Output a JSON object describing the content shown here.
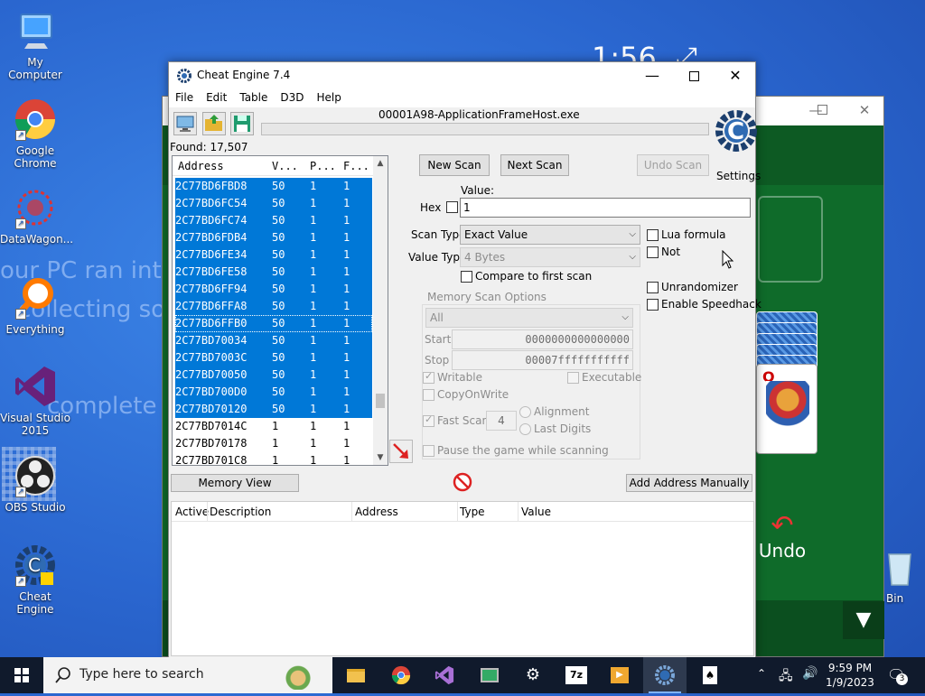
{
  "desktop": {
    "icons": [
      {
        "label": "My Computer"
      },
      {
        "label": "Google Chrome"
      },
      {
        "label": "DataWagon..."
      },
      {
        "label": "Everything"
      },
      {
        "label": "Visual Studio 2015"
      },
      {
        "label": "OBS Studio"
      },
      {
        "label": "Cheat Engine"
      },
      {
        "label": "e Bin"
      }
    ],
    "wallpaper_lines": [
      "our PC ran into",
      "collecting so",
      "complete"
    ]
  },
  "solitaire": {
    "timer": "1:56",
    "card_rank": "Q",
    "undo_label": "Undo",
    "colors": {
      "felt": "#0f6b2a"
    }
  },
  "cheat_engine": {
    "title": "Cheat Engine 7.4",
    "menu": [
      "File",
      "Edit",
      "Table",
      "D3D",
      "Help"
    ],
    "process": "00001A98-ApplicationFrameHost.exe",
    "found": "Found: 17,507",
    "settings_label": "Settings",
    "logo_text": "Cheat Engine",
    "results": {
      "columns": [
        "Address",
        "V...",
        "P...",
        "F..."
      ],
      "rows": [
        {
          "address": "2C77BD6FBD8",
          "value": "50",
          "prev": "1",
          "first": "1",
          "selected": true
        },
        {
          "address": "2C77BD6FC54",
          "value": "50",
          "prev": "1",
          "first": "1",
          "selected": true
        },
        {
          "address": "2C77BD6FC74",
          "value": "50",
          "prev": "1",
          "first": "1",
          "selected": true
        },
        {
          "address": "2C77BD6FDB4",
          "value": "50",
          "prev": "1",
          "first": "1",
          "selected": true
        },
        {
          "address": "2C77BD6FE34",
          "value": "50",
          "prev": "1",
          "first": "1",
          "selected": true
        },
        {
          "address": "2C77BD6FE58",
          "value": "50",
          "prev": "1",
          "first": "1",
          "selected": true
        },
        {
          "address": "2C77BD6FF94",
          "value": "50",
          "prev": "1",
          "first": "1",
          "selected": true
        },
        {
          "address": "2C77BD6FFA8",
          "value": "50",
          "prev": "1",
          "first": "1",
          "selected": true
        },
        {
          "address": "2C77BD6FFB0",
          "value": "50",
          "prev": "1",
          "first": "1",
          "selected": true
        },
        {
          "address": "2C77BD70034",
          "value": "50",
          "prev": "1",
          "first": "1",
          "selected": true
        },
        {
          "address": "2C77BD7003C",
          "value": "50",
          "prev": "1",
          "first": "1",
          "selected": true
        },
        {
          "address": "2C77BD70050",
          "value": "50",
          "prev": "1",
          "first": "1",
          "selected": true
        },
        {
          "address": "2C77BD700D0",
          "value": "50",
          "prev": "1",
          "first": "1",
          "selected": true
        },
        {
          "address": "2C77BD70120",
          "value": "50",
          "prev": "1",
          "first": "1",
          "selected": true
        },
        {
          "address": "2C77BD7014C",
          "value": "1",
          "prev": "1",
          "first": "1",
          "selected": false
        },
        {
          "address": "2C77BD70178",
          "value": "1",
          "prev": "1",
          "first": "1",
          "selected": false
        },
        {
          "address": "2C77BD701C8",
          "value": "1",
          "prev": "1",
          "first": "1",
          "selected": false
        }
      ]
    },
    "new_scan": "New Scan",
    "next_scan": "Next Scan",
    "undo_scan": "Undo Scan",
    "value_label": "Value:",
    "hex_label": "Hex",
    "value": "1",
    "scan_type_label": "Scan Type",
    "scan_type": "Exact Value",
    "value_type_label": "Value Type",
    "value_type": "4 Bytes",
    "compare_first": "Compare to first scan",
    "lua_formula": "Lua formula",
    "not_label": "Not",
    "unrandomizer": "Unrandomizer",
    "speedhack": "Enable Speedhack",
    "memory_options": "Memory Scan Options",
    "region": "All",
    "start_label": "Start",
    "start_value": "0000000000000000",
    "stop_label": "Stop",
    "stop_value": "00007fffffffffff",
    "writable": "Writable",
    "executable": "Executable",
    "copy_on_write": "CopyOnWrite",
    "fast_scan": "Fast Scan",
    "fast_scan_value": "4",
    "alignment": "Alignment",
    "last_digits": "Last Digits",
    "pause_game": "Pause the game while scanning",
    "memory_view": "Memory View",
    "add_manually": "Add Address Manually",
    "table_columns": [
      "Active",
      "Description",
      "Address",
      "Type",
      "Value"
    ]
  },
  "taskbar": {
    "search_placeholder": "Type here to search",
    "time": "9:59 PM",
    "date": "1/9/2023",
    "notifications": "3",
    "archive_label": "7z"
  }
}
